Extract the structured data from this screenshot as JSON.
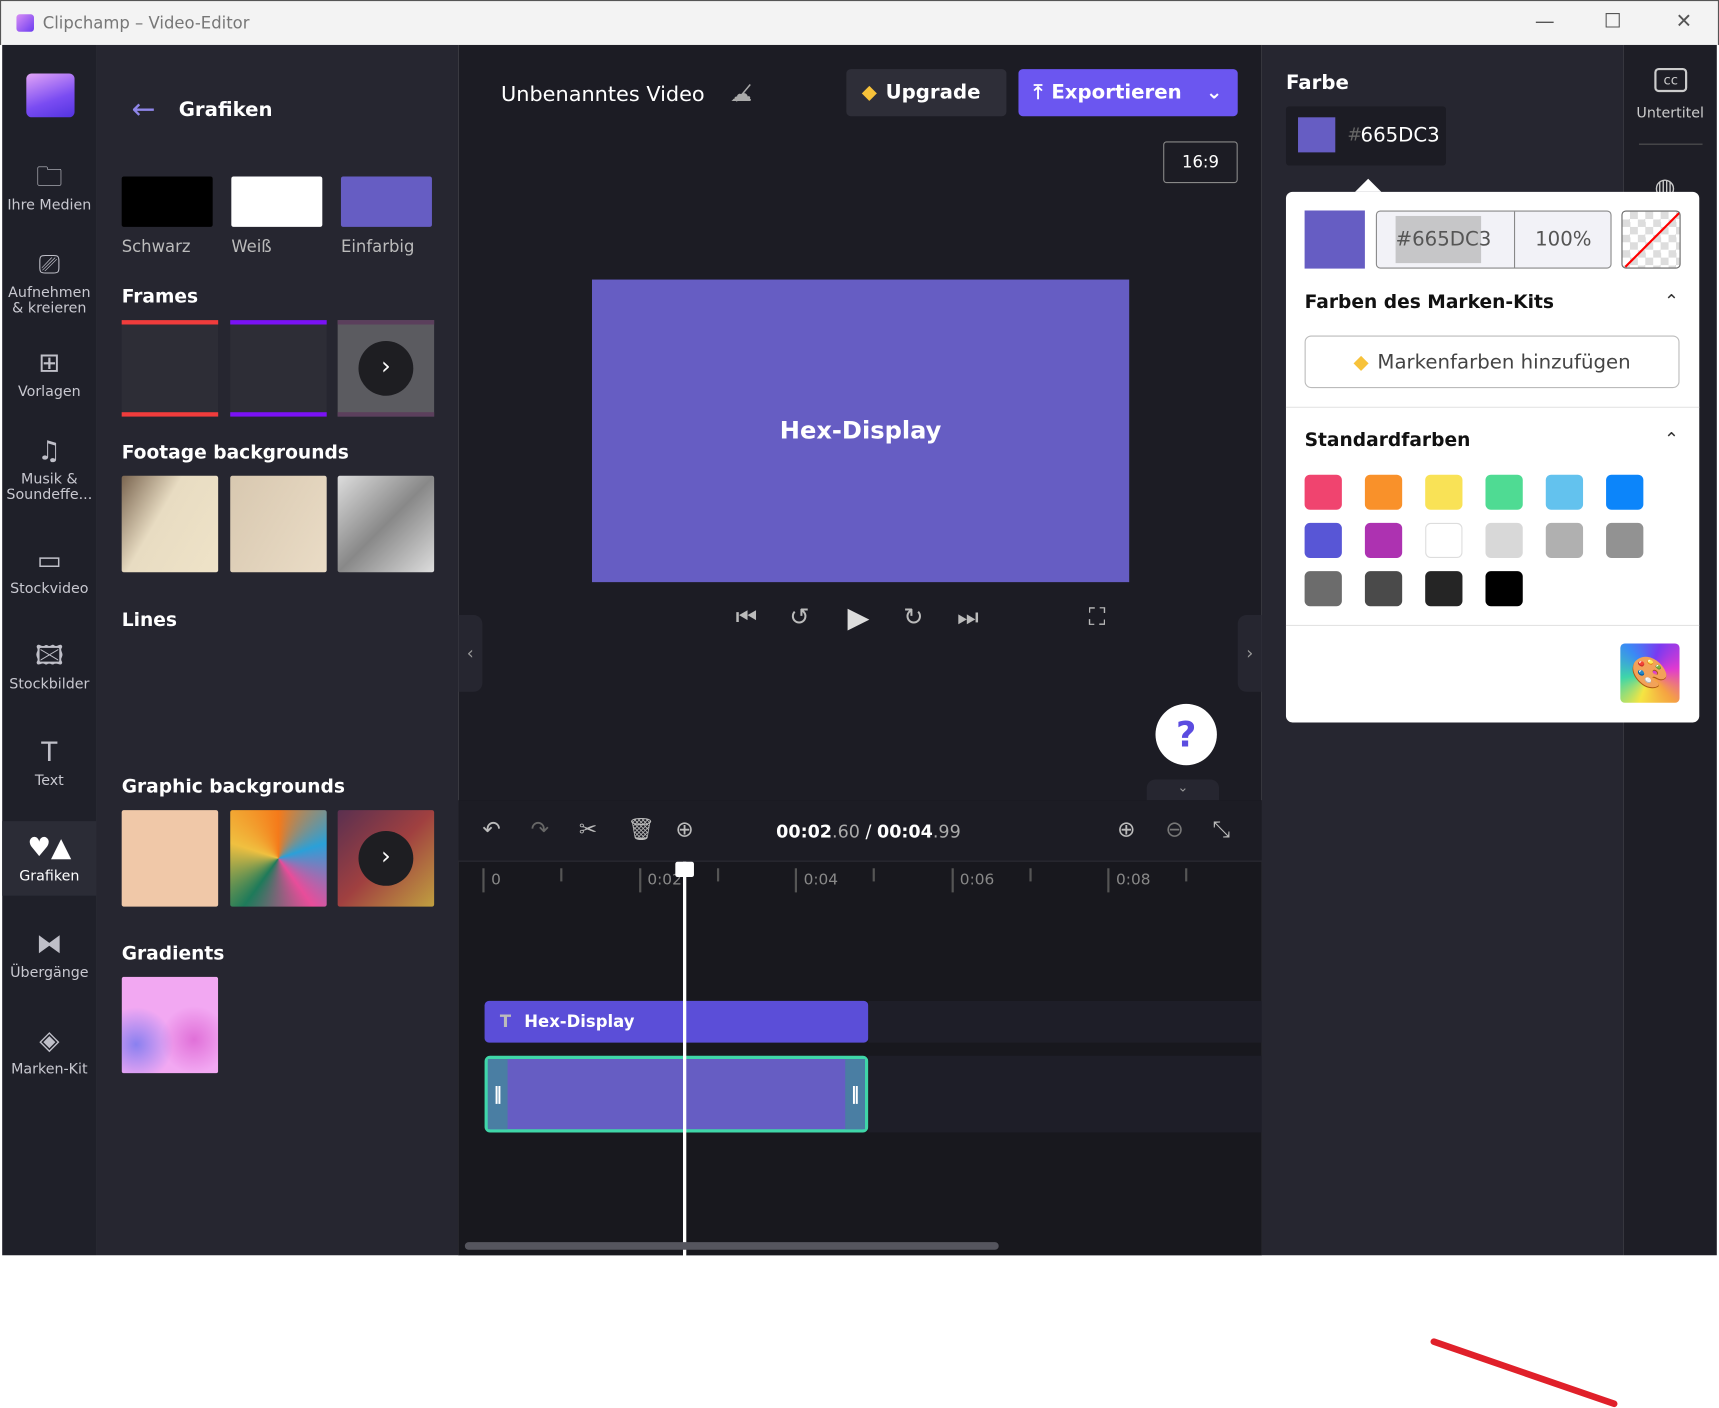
{
  "window": {
    "title": "Clipchamp – Video-Editor",
    "minimize": "—",
    "maximize": "☐",
    "close": "✕"
  },
  "rail": [
    {
      "label": "Ihre Medien",
      "icon": "folder-icon",
      "glyph": "🗀"
    },
    {
      "label": "Aufnehmen & kreieren",
      "icon": "camera-icon",
      "glyph": "⎚"
    },
    {
      "label": "Vorlagen",
      "icon": "templates-icon",
      "glyph": "⊞"
    },
    {
      "label": "Musik & Soundeffe...",
      "icon": "music-icon",
      "glyph": "♫"
    },
    {
      "label": "Stockvideo",
      "icon": "film-icon",
      "glyph": "▭"
    },
    {
      "label": "Stockbilder",
      "icon": "image-icon",
      "glyph": "🖾"
    },
    {
      "label": "Text",
      "icon": "text-icon",
      "glyph": "T"
    },
    {
      "label": "Grafiken",
      "icon": "shapes-icon",
      "glyph": "♥▲",
      "active": true
    },
    {
      "label": "Übergänge",
      "icon": "transitions-icon",
      "glyph": "⧓"
    },
    {
      "label": "Marken-Kit",
      "icon": "brand-kit-icon",
      "glyph": "◈"
    }
  ],
  "panel": {
    "title": "Grafiken",
    "solids": [
      {
        "label": "Schwarz",
        "color": "#000000"
      },
      {
        "label": "Weiß",
        "color": "#ffffff"
      },
      {
        "label": "Einfarbig",
        "color": "#665DC3"
      }
    ],
    "sections": {
      "frames": "Frames",
      "footage": "Footage backgrounds",
      "lines": "Lines",
      "graphic": "Graphic backgrounds",
      "gradients": "Gradients"
    }
  },
  "header": {
    "project_title": "Unbenanntes Video",
    "upgrade": "Upgrade",
    "export": "Exportieren",
    "aspect": "16:9"
  },
  "preview": {
    "text": "Hex-Display",
    "bg": "#665DC3"
  },
  "help": "?",
  "timeline": {
    "current": "00:02",
    "current_frac": ".60",
    "sep": " / ",
    "total": "00:04",
    "total_frac": ".99",
    "ticks": [
      "0",
      "0:02",
      "0:04",
      "0:06",
      "0:08"
    ],
    "text_clip": "Hex-Display"
  },
  "props": {
    "heading": "Farbe",
    "hash": "#",
    "hex": "665DC3"
  },
  "rrail": {
    "subtitles": "Untertitel"
  },
  "picker": {
    "hex": "#665DC3",
    "opacity": "100%",
    "brand_heading": "Farben des Marken-Kits",
    "brand_button": "Markenfarben hinzufügen",
    "std_heading": "Standardfarben",
    "swatches": [
      "#F0446F",
      "#F9912A",
      "#F9E256",
      "#4FDB93",
      "#63C2EE",
      "#0C85FA",
      "#5856D6",
      "#AD32B1",
      "#FFFFFF",
      "#D8D8D8",
      "#B0B0B0",
      "#929292",
      "#6C6C6C",
      "#4A4A4A",
      "#252525",
      "#000000"
    ]
  }
}
